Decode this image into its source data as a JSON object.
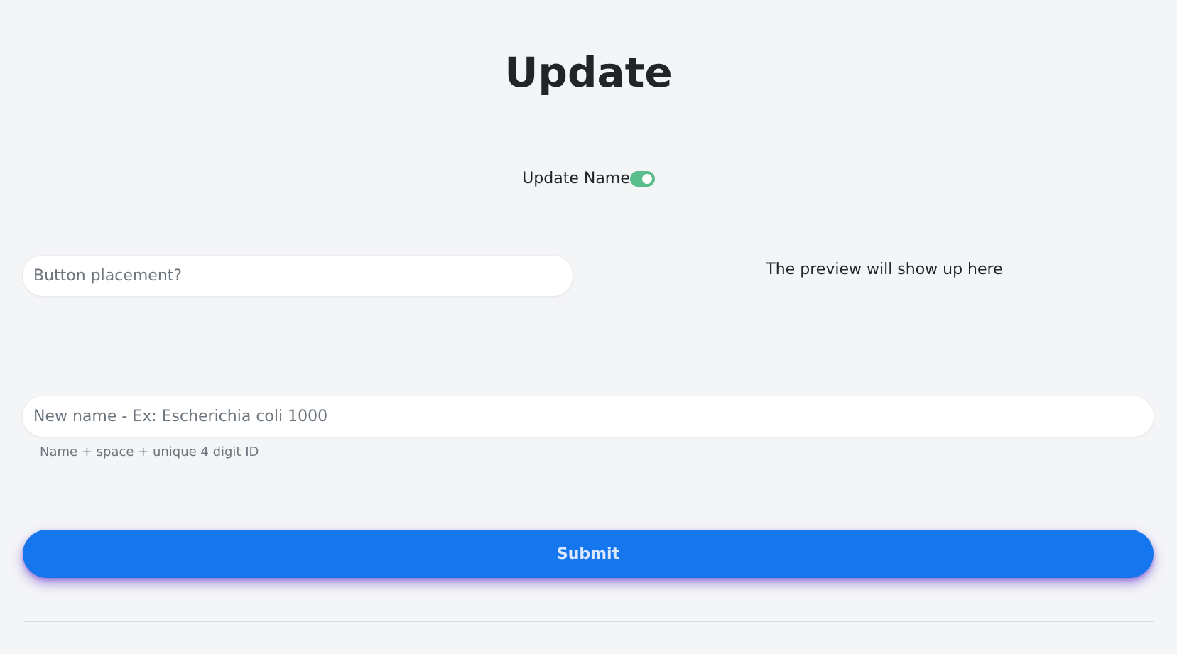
{
  "header": {
    "title": "Update"
  },
  "toggle": {
    "label": "Update Name",
    "state": "on",
    "color": "#5cbe8c"
  },
  "placement": {
    "placeholder": "Button placement?"
  },
  "preview": {
    "text": "The preview will show up here"
  },
  "name": {
    "placeholder": "New name - Ex: Escherichia coli 1000",
    "helper": "Name + space + unique 4 digit ID"
  },
  "submit": {
    "label": "Submit",
    "color": "#1576ee"
  }
}
